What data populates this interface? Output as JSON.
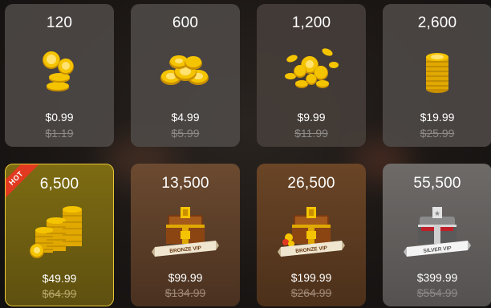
{
  "packages": [
    {
      "amount": "120",
      "price": "$0.99",
      "original_price": "$1.19",
      "icon": "coins-small-icon"
    },
    {
      "amount": "600",
      "price": "$4.99",
      "original_price": "$5.99",
      "icon": "coin-pile-icon"
    },
    {
      "amount": "1,200",
      "price": "$9.99",
      "original_price": "$11.99",
      "icon": "coin-scatter-icon"
    },
    {
      "amount": "2,600",
      "price": "$19.99",
      "original_price": "$25.99",
      "icon": "coin-stack-icon"
    },
    {
      "amount": "6,500",
      "price": "$49.99",
      "original_price": "$64.99",
      "icon": "coin-stacks-icon",
      "badge": "HOT"
    },
    {
      "amount": "13,500",
      "price": "$99.99",
      "original_price": "$134.99",
      "icon": "treasure-chest-icon",
      "ribbon": "BRONZE VIP"
    },
    {
      "amount": "26,500",
      "price": "$199.99",
      "original_price": "$264.99",
      "icon": "treasure-chest-icon",
      "ribbon": "BRONZE VIP"
    },
    {
      "amount": "55,500",
      "price": "$399.99",
      "original_price": "$554.99",
      "icon": "silver-chest-icon",
      "ribbon": "SILVER VIP"
    }
  ],
  "colors": {
    "coin": "#f5c400",
    "coin_dark": "#c98f00",
    "hot_badge": "#e23a20",
    "selected_border": "#e6c636"
  }
}
